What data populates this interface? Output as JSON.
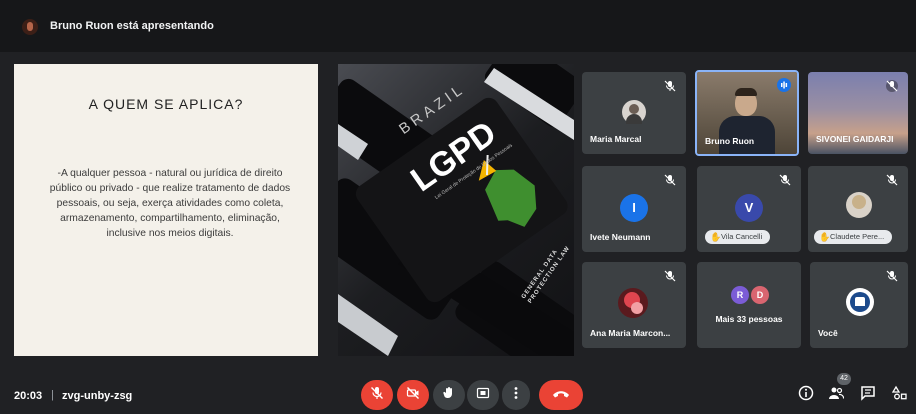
{
  "presenter_bar": {
    "text": "Bruno Ruon está apresentando"
  },
  "slide": {
    "title": "A QUEM SE APLICA?",
    "body": "-A qualquer pessoa - natural ou jurídica de direito público ou privado - que realize tratamento de dados pessoais, ou seja, exerça atividades como coleta, armazenamento, compartilhamento, eliminação, inclusive nos meios digitais."
  },
  "cover": {
    "brazil": "BRAZIL",
    "lgpd": "LGPD",
    "subtitle": "Lei Geral de Proteção de Dados Pessoais",
    "side_text": "GENERAL DATA PROTECTION LAW"
  },
  "participants": [
    {
      "name": "Maria Marcal",
      "muted": true
    },
    {
      "name": "Bruno Ruon",
      "speaking": true
    },
    {
      "name": "SIVONEI GAIDARJI",
      "muted": true
    },
    {
      "name": "Ivete Neumann",
      "initial": "I",
      "muted": true
    },
    {
      "name": "Vila Cancelli",
      "initial": "V",
      "muted": true,
      "hand_raised": true
    },
    {
      "name": "Claudete Pere...",
      "muted": true,
      "hand_raised": true
    },
    {
      "name": "Ana Maria Marcon...",
      "muted": true
    },
    {
      "name": "Mais 33 pessoas",
      "initials": [
        "R",
        "D"
      ]
    },
    {
      "name": "Você",
      "muted": true
    }
  ],
  "meeting": {
    "time": "20:03",
    "separator": "|",
    "code": "zvg-unby-zsg"
  },
  "badges": {
    "people_count": "42"
  },
  "colors": {
    "avatar_blue": "#1a73e8",
    "avatar_purple": "#7b5cd6",
    "avatar_pink": "#d96570",
    "end_call_red": "#ea4335",
    "speaking_border": "#8ab4f8"
  },
  "icons": [
    "mic-off-icon",
    "camera-off-icon",
    "raise-hand-icon",
    "present-screen-icon",
    "more-options-icon",
    "end-call-icon",
    "info-icon",
    "people-icon",
    "chat-icon",
    "activities-icon"
  ]
}
